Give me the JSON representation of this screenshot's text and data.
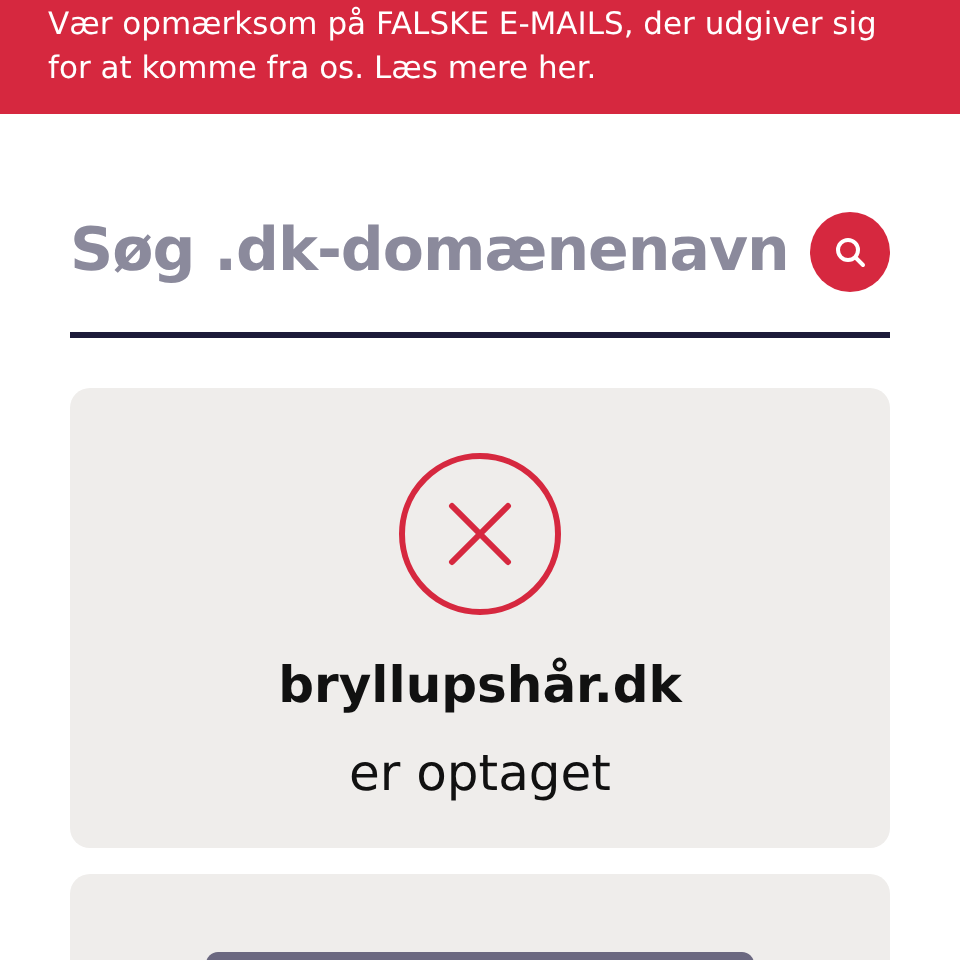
{
  "banner": {
    "text": "Vær opmærksom på FALSKE E-MAILS, der udgiver sig for at komme fra os. Læs mere her."
  },
  "search": {
    "placeholder": "Søg .dk-domænenavn"
  },
  "result": {
    "taken": true,
    "domain": "bryllupshår.dk",
    "message": "er optaget"
  }
}
